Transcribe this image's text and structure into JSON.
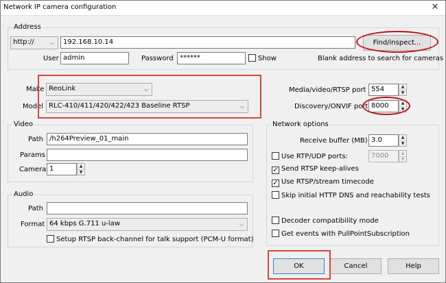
{
  "window": {
    "title": "Network IP camera configuration",
    "close_glyph": "✕"
  },
  "address": {
    "group_title": "Address",
    "protocol": "http://",
    "url": "192.168.10.14",
    "find_button": "Find/inspect...",
    "user_label": "User",
    "user_value": "admin",
    "password_label": "Password",
    "password_value": "******",
    "show_label": "Show",
    "show_checked": false,
    "hint": "Blank address to search for cameras"
  },
  "device": {
    "make_label": "Make",
    "make_value": "ReoLink",
    "model_label": "Model",
    "model_value": "RLC-410/411/420/422/423 Baseline RTSP",
    "media_port_label": "Media/video/RTSP port",
    "media_port_value": "554",
    "discovery_port_label": "Discovery/ONVIF port",
    "discovery_port_value": "8000"
  },
  "video": {
    "group_title": "Video",
    "path_label": "Path",
    "path_value": "/h264Preview_01_main",
    "params_label": "Params",
    "params_value": "",
    "camera_label": "Camera",
    "camera_value": "1"
  },
  "audio": {
    "group_title": "Audio",
    "path_label": "Path",
    "path_value": "",
    "format_label": "Format",
    "format_value": "64 kbps G.711 u-law",
    "backchannel_label": "Setup RTSP back-channel for talk support (PCM-U format)",
    "backchannel_checked": false
  },
  "network": {
    "group_title": "Network options",
    "receive_buffer_label": "Receive buffer (MB)",
    "receive_buffer_value": "3.0",
    "use_rtp_label": "Use RTP/UDP ports:",
    "rtp_port_value": "7000",
    "options": [
      {
        "label": "Send RTSP keep-alives",
        "checked": true
      },
      {
        "label": "Use RTSP/stream timecode",
        "checked": true
      },
      {
        "label": "Skip initial HTTP DNS and reachability tests",
        "checked": false
      },
      {
        "label": "Decoder compatibility mode",
        "checked": false
      },
      {
        "label": "Get events with PullPointSubscription",
        "checked": false
      }
    ]
  },
  "buttons": {
    "ok": "OK",
    "cancel": "Cancel",
    "help": "Help"
  },
  "icons": {
    "checkmark": "✓",
    "chevron": "⌵",
    "spin_up": "▲",
    "spin_down": "▼"
  },
  "colors": {
    "highlight_rect": "#d9443a",
    "highlight_oval": "#b8131b",
    "window_bg": "#f0f0f0"
  }
}
